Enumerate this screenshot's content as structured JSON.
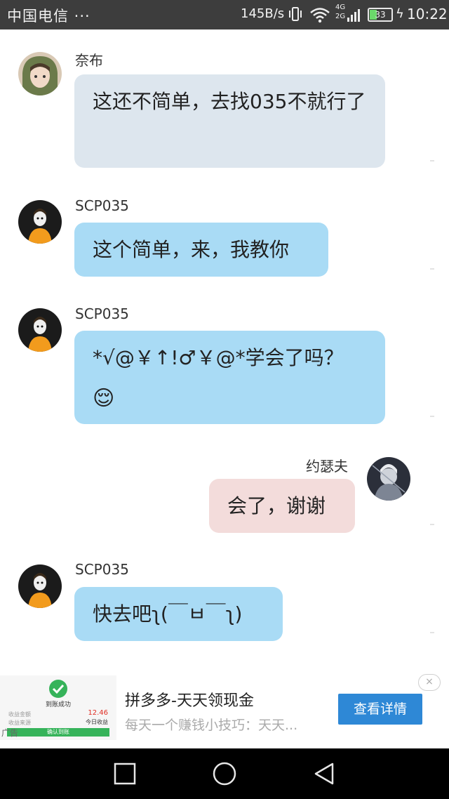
{
  "status_bar": {
    "carrier": "中国电信 ···",
    "net_speed": "145B/s",
    "network_type": "4G\n2G",
    "battery_level": "33",
    "time": "10:22",
    "icons": [
      "vibrate-icon",
      "wifi-icon",
      "signal-icon",
      "battery-icon",
      "charging-icon"
    ]
  },
  "messages": [
    {
      "sender": "奈布",
      "text": "这还不简单，去找035不就行了",
      "side": "left",
      "bubble_color": "#dde6ee"
    },
    {
      "sender": "SCP035",
      "text": "这个简单，来，我教你",
      "side": "left",
      "bubble_color": "#a9dbf5"
    },
    {
      "sender": "SCP035",
      "text": "*√@￥↑!♂￥@*学会了吗？",
      "emoji": "😌",
      "side": "left",
      "bubble_color": "#a9dbf5"
    },
    {
      "sender": "约瑟夫",
      "text": "会了，谢谢",
      "side": "right",
      "bubble_color": "#f3dcdb"
    },
    {
      "sender": "SCP035",
      "text": "快去吧ʅ(￣ㅂ￣ʅ)",
      "side": "left",
      "bubble_color": "#a9dbf5"
    }
  ],
  "ad": {
    "thumb_success": "到账成功",
    "thumb_row1": "收益金额",
    "thumb_row2": "收益来源",
    "thumb_amount": "12.46",
    "thumb_today": "今日收益",
    "thumb_confirm": "确认到账",
    "tag": "广告",
    "title": "拼多多-天天领现金",
    "description": "每天一个赚钱小技巧：天天...",
    "cta": "查看详情",
    "close": "×"
  },
  "nav_bar": {
    "buttons": [
      "recents-icon",
      "home-icon",
      "back-icon"
    ]
  }
}
